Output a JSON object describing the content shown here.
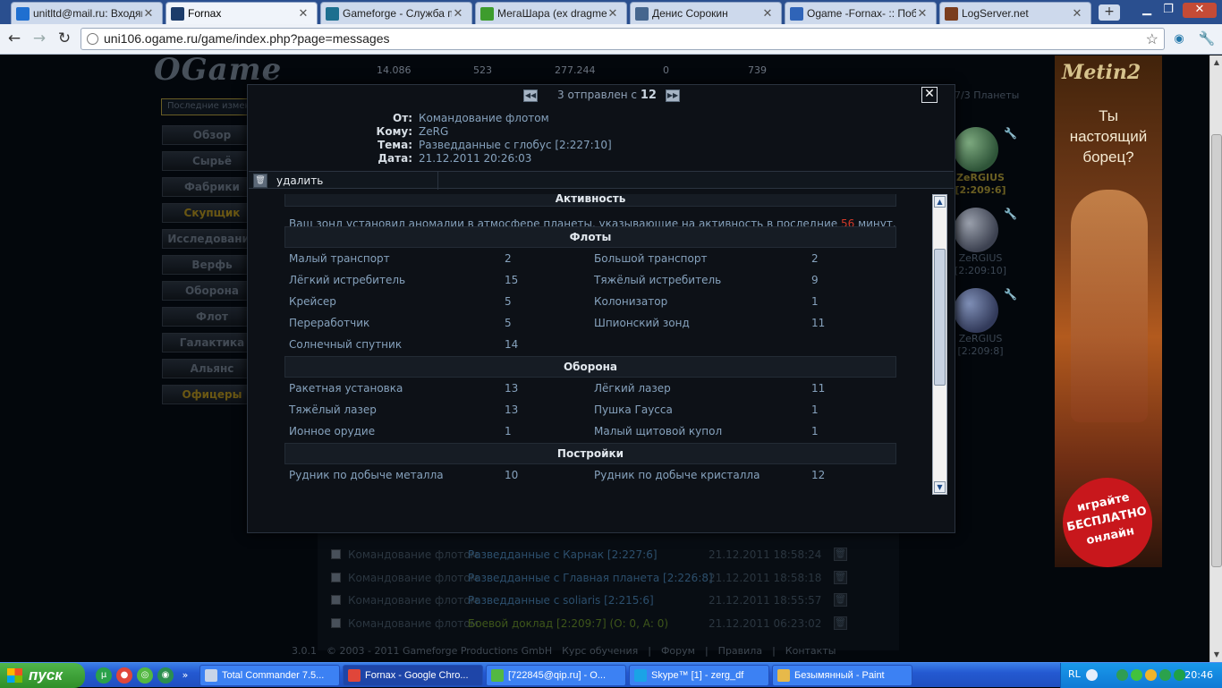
{
  "browser": {
    "tabs": [
      {
        "title": "unitltd@mail.ru: Входящи",
        "icon": "at-icon",
        "color": "#1f6fd0"
      },
      {
        "title": "Fornax",
        "icon": "ogame-icon",
        "color": "#1c3c6a",
        "active": true
      },
      {
        "title": "Gameforge - Служба под",
        "icon": "gameforge-icon",
        "color": "#1d6f8f"
      },
      {
        "title": "МегаШара (ex dragme.tv",
        "icon": "check-icon",
        "color": "#3d9c2d"
      },
      {
        "title": "Денис Сорокин",
        "icon": "vk-icon",
        "color": "#45668e"
      },
      {
        "title": "Ogame -Fornax- :: Побед",
        "icon": "forum-icon",
        "color": "#2f64b8"
      },
      {
        "title": "LogServer.net",
        "icon": "logserver-icon",
        "color": "#7a3d1e"
      }
    ],
    "url": "uni106.ogame.ru/game/index.php?page=messages"
  },
  "game": {
    "logo": "OGame",
    "resources": [
      "14.086",
      "523",
      "277.244",
      "0",
      "739"
    ],
    "search_placeholder": "Последние измен",
    "menu": [
      "Обзор",
      "Сырьё",
      "Фабрики",
      "Скупщик",
      "Исследования",
      "Верфь",
      "Оборона",
      "Флот",
      "Галактика",
      "Альянс",
      "Офицеры"
    ],
    "planets_header": "7/3 Планеты",
    "planets": [
      {
        "name": "ZeRGIUS",
        "coords": "[2:209:6]",
        "selected": true
      },
      {
        "name": "ZeRGIUS",
        "coords": "[2:209:10]"
      },
      {
        "name": "ZeRGIUS",
        "coords": "[2:209:8]"
      }
    ],
    "messages": [
      {
        "from": "Командование флотом",
        "subject": "Разведданные с Карнак [2:227:6]",
        "date": "21.12.2011 18:58:24"
      },
      {
        "from": "Командование флотом",
        "subject": "Разведданные с Главная планета [2:226:8]",
        "date": "21.12.2011 18:58:18"
      },
      {
        "from": "Командование флотом",
        "subject": "Разведданные с soliaris [2:215:6]",
        "date": "21.12.2011 18:55:57"
      },
      {
        "from": "Командование флотом",
        "subject": "Боевой доклад [2:209:7] (О: 0, А: 0)",
        "date": "21.12.2011 06:23:02",
        "combat": true
      }
    ],
    "footer": [
      "3.0.1",
      "© 2003 - 2011 Gameforge Productions GmbH",
      "Курс обучения",
      "|",
      "Форум",
      "|",
      "Правила",
      "|",
      "Контакты"
    ]
  },
  "ad": {
    "logo": "Metin2",
    "line1": "Ты",
    "line2": "настоящий",
    "line3": "борец?",
    "badge1": "играйте",
    "badge2": "БЕСПЛАТНО",
    "badge3": "онлайн"
  },
  "popup": {
    "pager_sent": "3 отправлен с",
    "pager_total": "12",
    "header": [
      {
        "label": "От:",
        "value": "Командование флотом"
      },
      {
        "label": "Кому:",
        "value": "ZeRG"
      },
      {
        "label": "Тема:",
        "value": "Разведданные с глобус [2:227:10]"
      },
      {
        "label": "Дата:",
        "value": "21.12.2011 20:26:03"
      }
    ],
    "delete_label": "удалить",
    "activity_title": "Активность",
    "activity_text": "Ваш зонд установил аномалии в атмосфере планеты, указывающие на активность в последние",
    "activity_minutes": "56",
    "activity_unit": "минут.",
    "sections": [
      {
        "title": "Флоты",
        "rows": [
          [
            {
              "name": "Малый транспорт",
              "value": "2"
            },
            {
              "name": "Большой транспорт",
              "value": "2"
            }
          ],
          [
            {
              "name": "Лёгкий истребитель",
              "value": "15"
            },
            {
              "name": "Тяжёлый истребитель",
              "value": "9"
            }
          ],
          [
            {
              "name": "Крейсер",
              "value": "5"
            },
            {
              "name": "Колонизатор",
              "value": "1"
            }
          ],
          [
            {
              "name": "Переработчик",
              "value": "5"
            },
            {
              "name": "Шпионский зонд",
              "value": "11"
            }
          ],
          [
            {
              "name": "Солнечный спутник",
              "value": "14"
            }
          ]
        ]
      },
      {
        "title": "Оборона",
        "rows": [
          [
            {
              "name": "Ракетная установка",
              "value": "13"
            },
            {
              "name": "Лёгкий лазер",
              "value": "11"
            }
          ],
          [
            {
              "name": "Тяжёлый лазер",
              "value": "13"
            },
            {
              "name": "Пушка Гаусса",
              "value": "1"
            }
          ],
          [
            {
              "name": "Ионное орудие",
              "value": "1"
            },
            {
              "name": "Малый щитовой купол",
              "value": "1"
            }
          ]
        ]
      },
      {
        "title": "Постройки",
        "rows": [
          [
            {
              "name": "Рудник по добыче металла",
              "value": "10"
            },
            {
              "name": "Рудник по добыче кристалла",
              "value": "12"
            }
          ]
        ]
      }
    ]
  },
  "taskbar": {
    "start": "пуск",
    "tasks": [
      {
        "title": "Total Commander 7.5...",
        "color": "#c8d4e8"
      },
      {
        "title": "Fornax - Google Chro...",
        "color": "#e0463a",
        "active": true
      },
      {
        "title": "[722845@qip.ru] - О...",
        "color": "#53b842"
      },
      {
        "title": "Skype™ [1] - zerg_df",
        "color": "#1aa3e6"
      },
      {
        "title": "Безымянный - Paint",
        "color": "#e7b94a"
      }
    ],
    "lang": "RL",
    "clock": "20:46"
  }
}
